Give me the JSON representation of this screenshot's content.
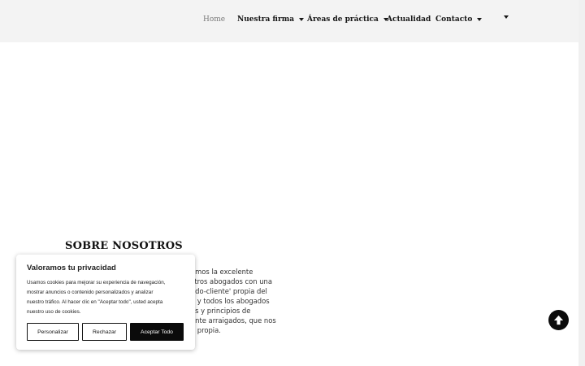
{
  "header": {
    "nav": [
      {
        "label": "Home",
        "active": true,
        "dropdown": false
      },
      {
        "label": "Nuestra firma",
        "active": false,
        "dropdown": true
      },
      {
        "label": "Áreas de práctica",
        "active": false,
        "dropdown": true
      },
      {
        "label": "Actualidad",
        "active": false,
        "dropdown": false
      },
      {
        "label": "Contacto",
        "active": false,
        "dropdown": true
      },
      {
        "label": "",
        "active": false,
        "dropdown": true
      }
    ]
  },
  "about": {
    "title": "SOBRE NOSOTROS",
    "visible_lines": [
      "amos la excelente",
      "stros abogados con una",
      "ado-cliente' propia del",
      "o y todos los abogados",
      "es y principios de",
      "ente arraigados, que nos",
      "a propia."
    ]
  },
  "cookie_banner": {
    "title": "Valoramos tu privacidad",
    "body_lines": [
      "Usamos cookies para mejorar su experiencia de navegación,",
      "mostrar anuncios o contenido personalizados y analizar",
      "nuestro tráfico. Al hacer clic en \"Aceptar todo\", usted acepta",
      "nuestro uso de cookies."
    ],
    "buttons": {
      "customize": "Personalizar",
      "reject": "Rechazar",
      "accept": "Aceptar Todo"
    }
  },
  "back_to_top": {
    "icon": "arrow-up-icon"
  },
  "colors": {
    "header_bg": "#f3f3f3",
    "nav_active": "#7a7a7a",
    "nav_text": "#161616",
    "primary_button": "#0b0b0b"
  }
}
